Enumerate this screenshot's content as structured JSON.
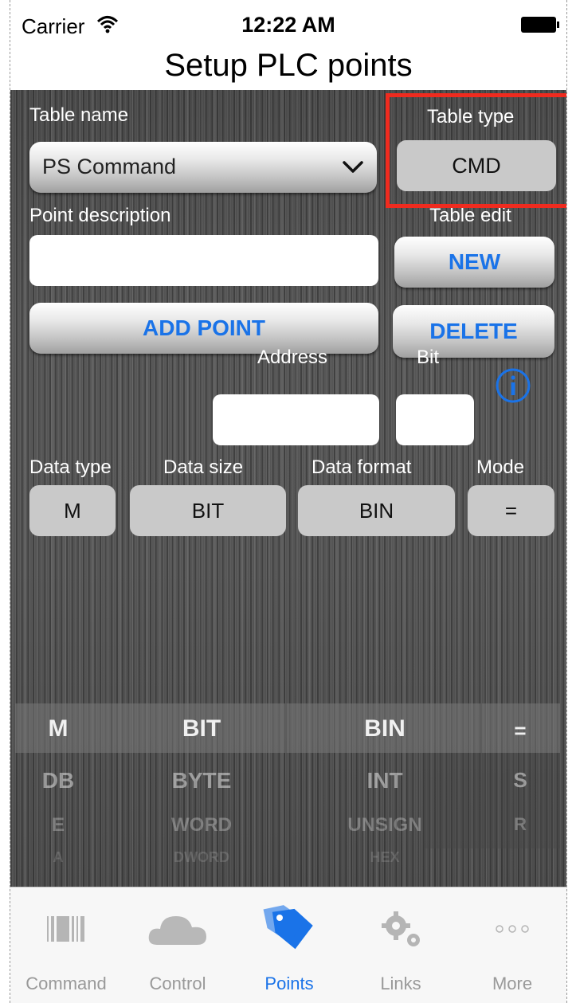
{
  "status": {
    "carrier": "Carrier",
    "time": "12:22 AM"
  },
  "nav": {
    "title": "Setup PLC points"
  },
  "form": {
    "table_name_label": "Table name",
    "table_name_value": "PS Command",
    "table_type_label": "Table type",
    "table_type_value": "CMD",
    "point_description_label": "Point description",
    "point_description_value": "",
    "table_edit_label": "Table edit",
    "new_label": "NEW",
    "add_point_label": "ADD POINT",
    "delete_label": "DELETE",
    "address_label": "Address",
    "address_value": "",
    "bit_label": "Bit",
    "bit_value": "",
    "data_type_label": "Data type",
    "data_size_label": "Data size",
    "data_format_label": "Data format",
    "mode_label": "Mode",
    "data_type_value": "M",
    "data_size_value": "BIT",
    "data_format_value": "BIN",
    "mode_value": "="
  },
  "picker": {
    "rows": [
      {
        "type": "M",
        "size": "BIT",
        "format": "BIN",
        "mode": "="
      },
      {
        "type": "DB",
        "size": "BYTE",
        "format": "INT",
        "mode": "S"
      },
      {
        "type": "E",
        "size": "WORD",
        "format": "UNSIGN",
        "mode": "R"
      },
      {
        "type": "A",
        "size": "DWORD",
        "format": "HEX",
        "mode": ""
      }
    ]
  },
  "tabs": [
    {
      "label": "Command",
      "icon": "barcode-icon"
    },
    {
      "label": "Control",
      "icon": "cloud-icon"
    },
    {
      "label": "Points",
      "icon": "tag-icon"
    },
    {
      "label": "Links",
      "icon": "gears-icon"
    },
    {
      "label": "More",
      "icon": "more-dots-icon"
    }
  ],
  "colors": {
    "accent": "#1a73e8",
    "highlight": "#ef2b1f"
  }
}
